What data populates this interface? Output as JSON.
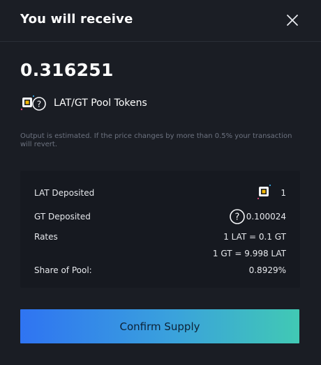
{
  "header": {
    "title": "You will receive",
    "close_icon": "close-icon"
  },
  "receive": {
    "amount": "0.316251",
    "token_label": "LAT/GT Pool Tokens",
    "icons": [
      "lat-token-icon",
      "gt-unknown-token-icon"
    ]
  },
  "note": "Output is estimated. If the price changes by more than 0.5% your transaction will revert.",
  "details": {
    "lat_deposited_label": "LAT Deposited",
    "lat_deposited_value": "1",
    "gt_deposited_label": "GT Deposited",
    "gt_deposited_value": "0.100024",
    "rates_label": "Rates",
    "rate_1": "1 LAT = 0.1 GT",
    "rate_2": "1 GT = 9.998 LAT",
    "share_label": "Share of Pool:",
    "share_value": "0.8929%"
  },
  "actions": {
    "confirm_label": "Confirm Supply"
  },
  "colors": {
    "background": "#1a1d24",
    "panel": "#161920",
    "accent_start": "#2f74f2",
    "accent_end": "#41c9b4",
    "muted_text": "#6d7380"
  }
}
